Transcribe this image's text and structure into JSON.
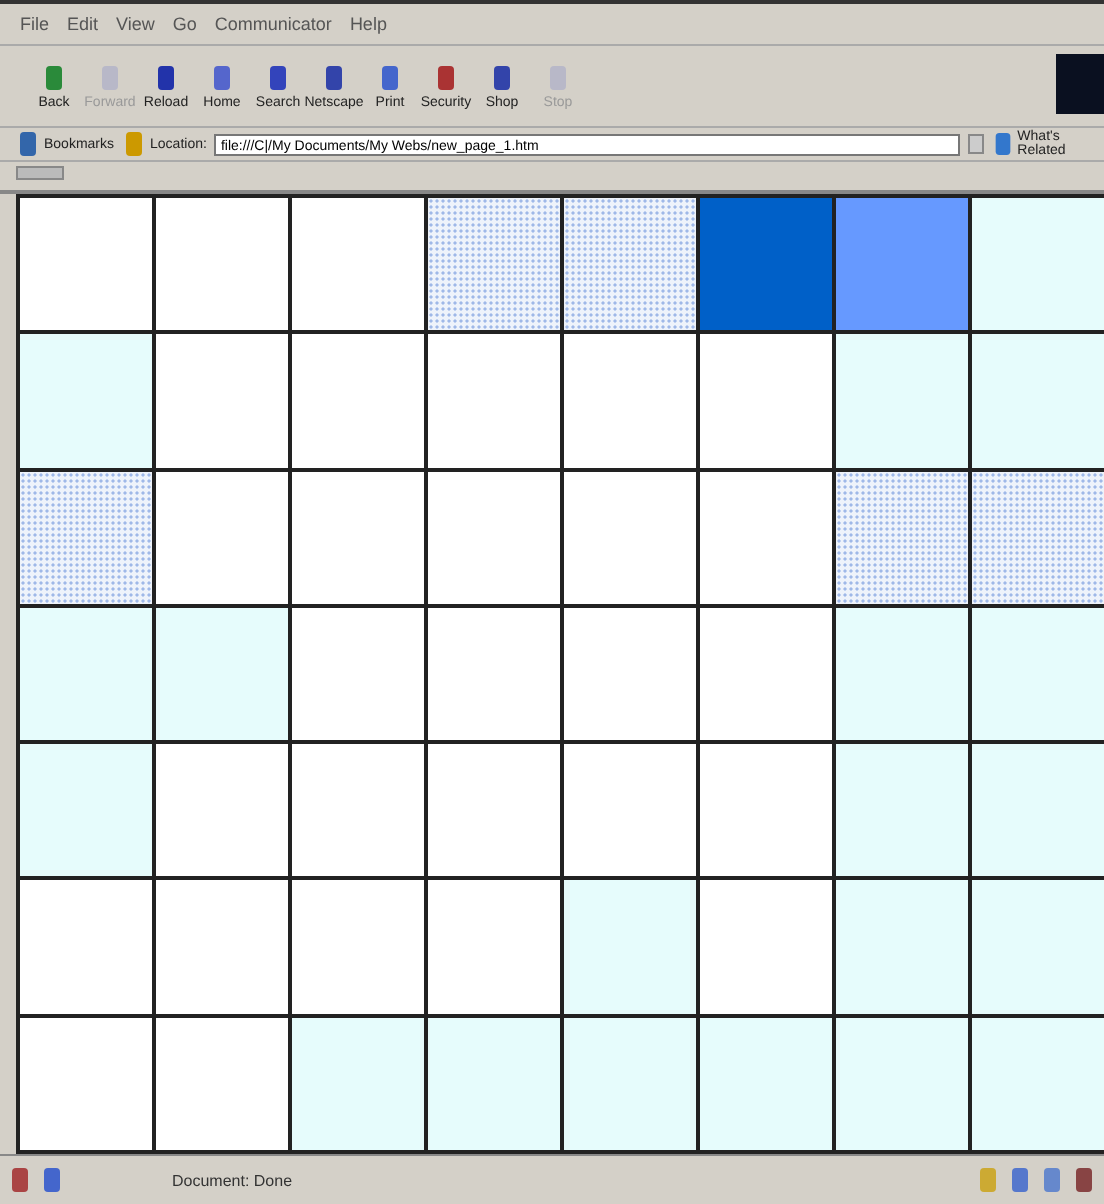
{
  "menu": [
    "File",
    "Edit",
    "View",
    "Go",
    "Communicator",
    "Help"
  ],
  "toolbar": [
    {
      "label": "Back",
      "disabled": false
    },
    {
      "label": "Forward",
      "disabled": true
    },
    {
      "label": "Reload",
      "disabled": false
    },
    {
      "label": "Home",
      "disabled": false
    },
    {
      "label": "Search",
      "disabled": false
    },
    {
      "label": "Netscape",
      "disabled": false
    },
    {
      "label": "Print",
      "disabled": false
    },
    {
      "label": "Security",
      "disabled": false
    },
    {
      "label": "Shop",
      "disabled": false
    },
    {
      "label": "Stop",
      "disabled": true
    }
  ],
  "location_bar": {
    "bookmarks": "Bookmarks",
    "location_label": "Location:",
    "value": "file:///C|/My Documents/My Webs/new_page_1.htm",
    "related": "What's Related"
  },
  "grid": [
    [
      {
        "kind": "solid",
        "color": "#ffffff"
      },
      {
        "kind": "solid",
        "color": "#ffffff"
      },
      {
        "kind": "solid",
        "color": "#ffffff"
      },
      {
        "kind": "dotted",
        "color": "#9fb8e8"
      },
      {
        "kind": "dotted",
        "color": "#9fb8e8"
      },
      {
        "kind": "solid",
        "color": "#0060c8"
      },
      {
        "kind": "solid",
        "color": "#6699ff"
      },
      {
        "kind": "solid",
        "color": "#e6fcfc"
      }
    ],
    [
      {
        "kind": "solid",
        "color": "#e6fcfc"
      },
      {
        "kind": "solid",
        "color": "#ffffff"
      },
      {
        "kind": "solid",
        "color": "#ffffff"
      },
      {
        "kind": "solid",
        "color": "#ffffff"
      },
      {
        "kind": "solid",
        "color": "#ffffff"
      },
      {
        "kind": "solid",
        "color": "#ffffff"
      },
      {
        "kind": "solid",
        "color": "#e6fcfc"
      },
      {
        "kind": "solid",
        "color": "#e6fcfc"
      }
    ],
    [
      {
        "kind": "dotted",
        "color": "#9fb8e8"
      },
      {
        "kind": "solid",
        "color": "#ffffff"
      },
      {
        "kind": "solid",
        "color": "#ffffff"
      },
      {
        "kind": "solid",
        "color": "#ffffff"
      },
      {
        "kind": "solid",
        "color": "#ffffff"
      },
      {
        "kind": "solid",
        "color": "#ffffff"
      },
      {
        "kind": "dotted",
        "color": "#9fb8e8"
      },
      {
        "kind": "dotted",
        "color": "#9fb8e8"
      }
    ],
    [
      {
        "kind": "solid",
        "color": "#e6fcfc"
      },
      {
        "kind": "solid",
        "color": "#e6fcfc"
      },
      {
        "kind": "solid",
        "color": "#ffffff"
      },
      {
        "kind": "solid",
        "color": "#ffffff"
      },
      {
        "kind": "solid",
        "color": "#ffffff"
      },
      {
        "kind": "solid",
        "color": "#ffffff"
      },
      {
        "kind": "solid",
        "color": "#e6fcfc"
      },
      {
        "kind": "solid",
        "color": "#e6fcfc"
      }
    ],
    [
      {
        "kind": "solid",
        "color": "#e6fcfc"
      },
      {
        "kind": "solid",
        "color": "#ffffff"
      },
      {
        "kind": "solid",
        "color": "#ffffff"
      },
      {
        "kind": "solid",
        "color": "#ffffff"
      },
      {
        "kind": "solid",
        "color": "#ffffff"
      },
      {
        "kind": "solid",
        "color": "#ffffff"
      },
      {
        "kind": "solid",
        "color": "#e6fcfc"
      },
      {
        "kind": "solid",
        "color": "#e6fcfc"
      }
    ],
    [
      {
        "kind": "solid",
        "color": "#ffffff"
      },
      {
        "kind": "solid",
        "color": "#ffffff"
      },
      {
        "kind": "solid",
        "color": "#ffffff"
      },
      {
        "kind": "solid",
        "color": "#ffffff"
      },
      {
        "kind": "solid",
        "color": "#e6fcfc"
      },
      {
        "kind": "solid",
        "color": "#ffffff"
      },
      {
        "kind": "solid",
        "color": "#e6fcfc"
      },
      {
        "kind": "solid",
        "color": "#e6fcfc"
      }
    ],
    [
      {
        "kind": "solid",
        "color": "#ffffff"
      },
      {
        "kind": "solid",
        "color": "#ffffff"
      },
      {
        "kind": "solid",
        "color": "#e6fcfc"
      },
      {
        "kind": "solid",
        "color": "#e6fcfc"
      },
      {
        "kind": "solid",
        "color": "#e6fcfc"
      },
      {
        "kind": "solid",
        "color": "#e6fcfc"
      },
      {
        "kind": "solid",
        "color": "#e6fcfc"
      },
      {
        "kind": "solid",
        "color": "#e6fcfc"
      }
    ]
  ],
  "status_bar": {
    "text": "Document: Done"
  }
}
